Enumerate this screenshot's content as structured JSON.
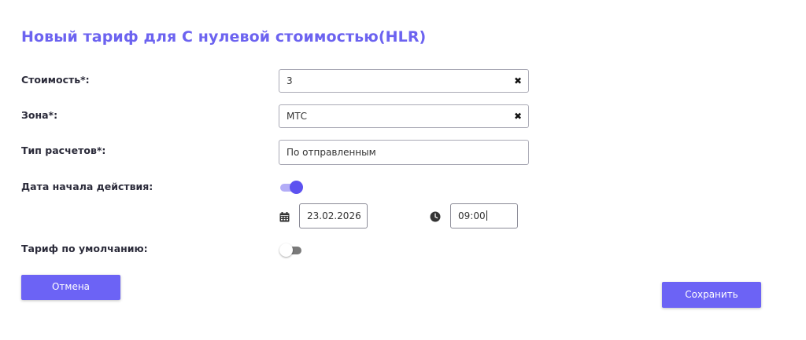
{
  "page": {
    "title": "Новый тариф для С нулевой стоимостью(HLR)"
  },
  "form": {
    "cost": {
      "label": "Стоимость*:",
      "value": "3"
    },
    "zone": {
      "label": "Зона*:",
      "value": "МТС"
    },
    "billing_type": {
      "label": "Тип расчетов*:",
      "value": "По отправленным"
    },
    "start_date": {
      "label": "Дата начала действия:",
      "toggle_on": true,
      "date": "23.02.2026",
      "time": "09:00"
    },
    "default_tariff": {
      "label": "Тариф по умолчанию:",
      "toggle_on": false
    }
  },
  "buttons": {
    "cancel": "Отмена",
    "save": "Сохранить"
  },
  "colors": {
    "accent": "#6c63f0",
    "button": "#6c63f5",
    "toggle_on_knob": "#5d52f0",
    "toggle_on_track": "#b3adf7"
  },
  "icons": {
    "clear": "close-icon",
    "calendar": "calendar-icon",
    "clock": "clock-icon"
  }
}
